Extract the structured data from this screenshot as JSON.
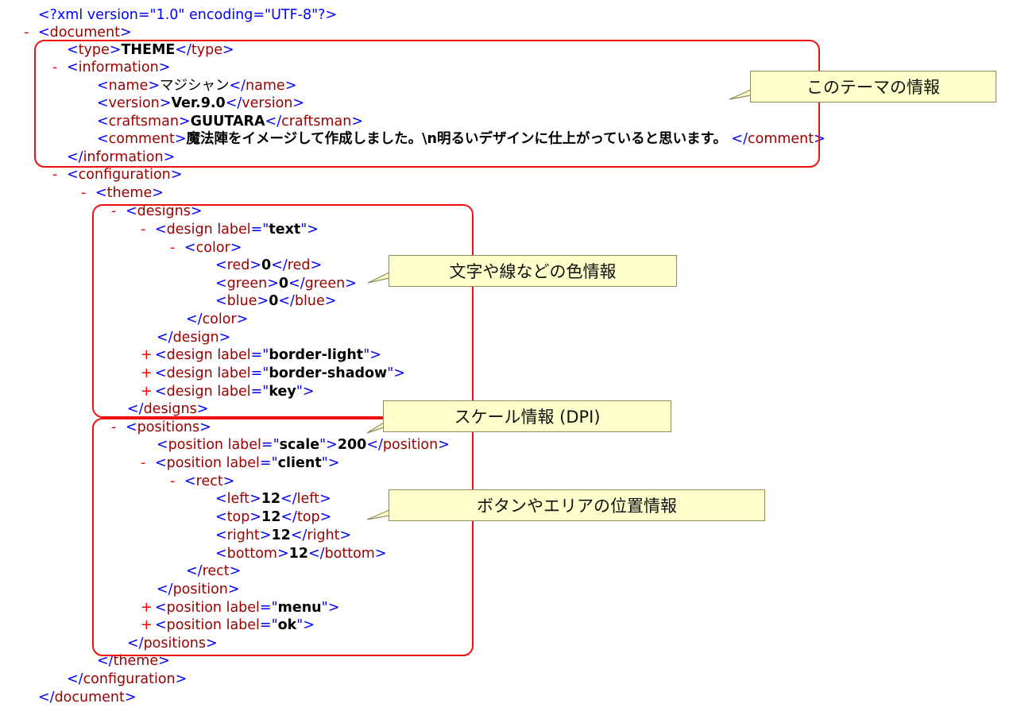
{
  "xml": {
    "decl": "<?xml version=\"1.0\" encoding=\"UTF-8\"?>",
    "collapse_symbol": "-",
    "expand_symbol": "+",
    "document_tag": "document",
    "type_tag": "type",
    "type_value": "THEME",
    "information_tag": "information",
    "name_tag": "name",
    "name_value": "マジシャン",
    "version_tag": "version",
    "version_value": "Ver.9.0",
    "craftsman_tag": "craftsman",
    "craftsman_value": "GUUTARA",
    "comment_tag": "comment",
    "comment_value": "魔法陣をイメージして作成しました。\\n明るいデザインに仕上がっていると思います。",
    "configuration_tag": "configuration",
    "theme_tag": "theme",
    "designs_tag": "designs",
    "design_tag": "design",
    "label_attr": "label",
    "design_text_label": "text",
    "color_tag": "color",
    "red_tag": "red",
    "red_value": "0",
    "green_tag": "green",
    "green_value": "0",
    "blue_tag": "blue",
    "blue_value": "0",
    "design_border_light_label": "border-light",
    "design_border_shadow_label": "border-shadow",
    "design_key_label": "key",
    "positions_tag": "positions",
    "position_tag": "position",
    "position_scale_label": "scale",
    "position_scale_value": "200",
    "position_client_label": "client",
    "rect_tag": "rect",
    "left_tag": "left",
    "left_value": "12",
    "top_tag": "top",
    "top_value": "12",
    "right_tag": "right",
    "right_value": "12",
    "bottom_tag": "bottom",
    "bottom_value": "12",
    "position_menu_label": "menu",
    "position_ok_label": "ok"
  },
  "callouts": {
    "theme_info": "このテーマの情報",
    "color_info": "文字や線などの色情報",
    "scale_info": "スケール情報 (DPI)",
    "position_info": "ボタンやエリアの位置情報"
  },
  "colors": {
    "bracket": "#0000ff",
    "element_name": "#990000",
    "text_value": "#000000",
    "toggle": "#ff0000",
    "highlight_frame": "#ee1111",
    "callout_bg": "#ffffcc"
  }
}
